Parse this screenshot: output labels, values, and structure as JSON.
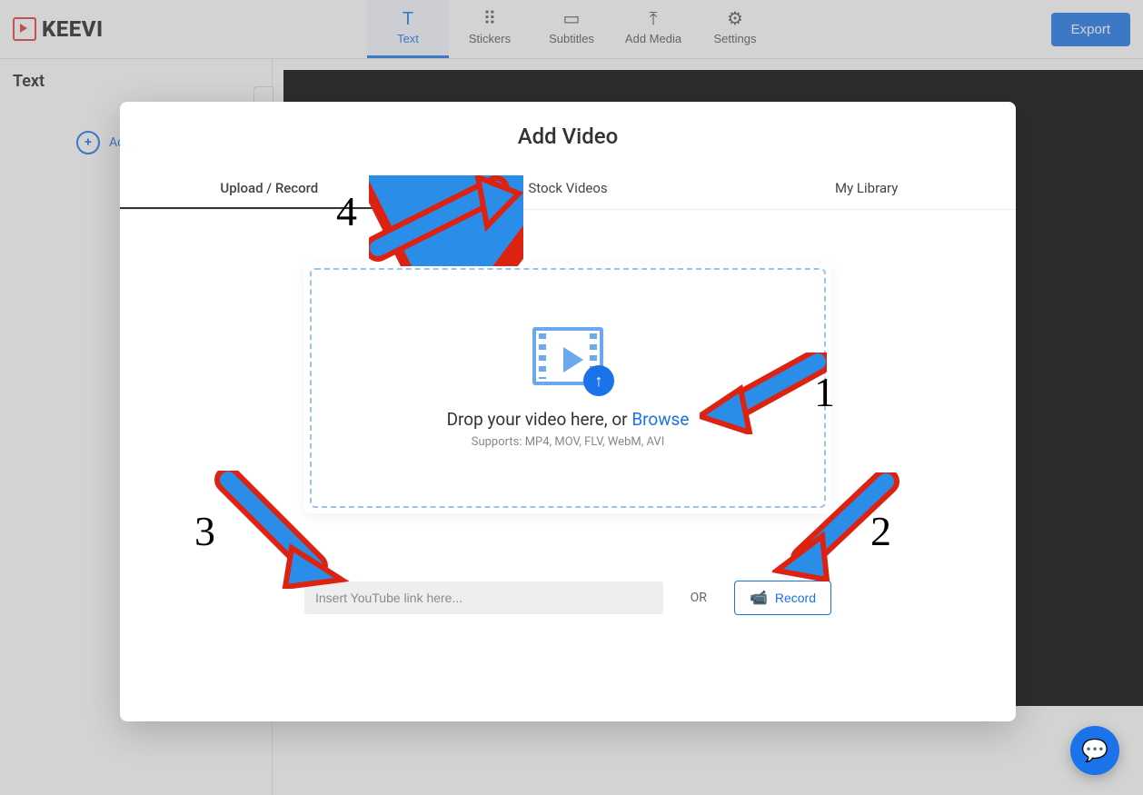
{
  "logo": {
    "text": "KEEVI"
  },
  "topbar": {
    "tabs": [
      {
        "label": "Text"
      },
      {
        "label": "Stickers"
      },
      {
        "label": "Subtitles"
      },
      {
        "label": "Add Media"
      },
      {
        "label": "Settings"
      }
    ],
    "export_label": "Export"
  },
  "sidebar": {
    "title": "Text",
    "add_text_label": "Add Text"
  },
  "modal": {
    "title": "Add Video",
    "tabs": {
      "upload": "Upload / Record",
      "stock": "Stock Videos",
      "library": "My Library"
    },
    "drop_text_prefix": "Drop your video here, or ",
    "browse_label": "Browse",
    "supports_text": "Supports: MP4, MOV, FLV, WebM, AVI",
    "youtube_placeholder": "Insert YouTube link here...",
    "or_label": "OR",
    "record_label": "Record"
  },
  "annotations": {
    "n1": "1",
    "n2": "2",
    "n3": "3",
    "n4": "4"
  }
}
